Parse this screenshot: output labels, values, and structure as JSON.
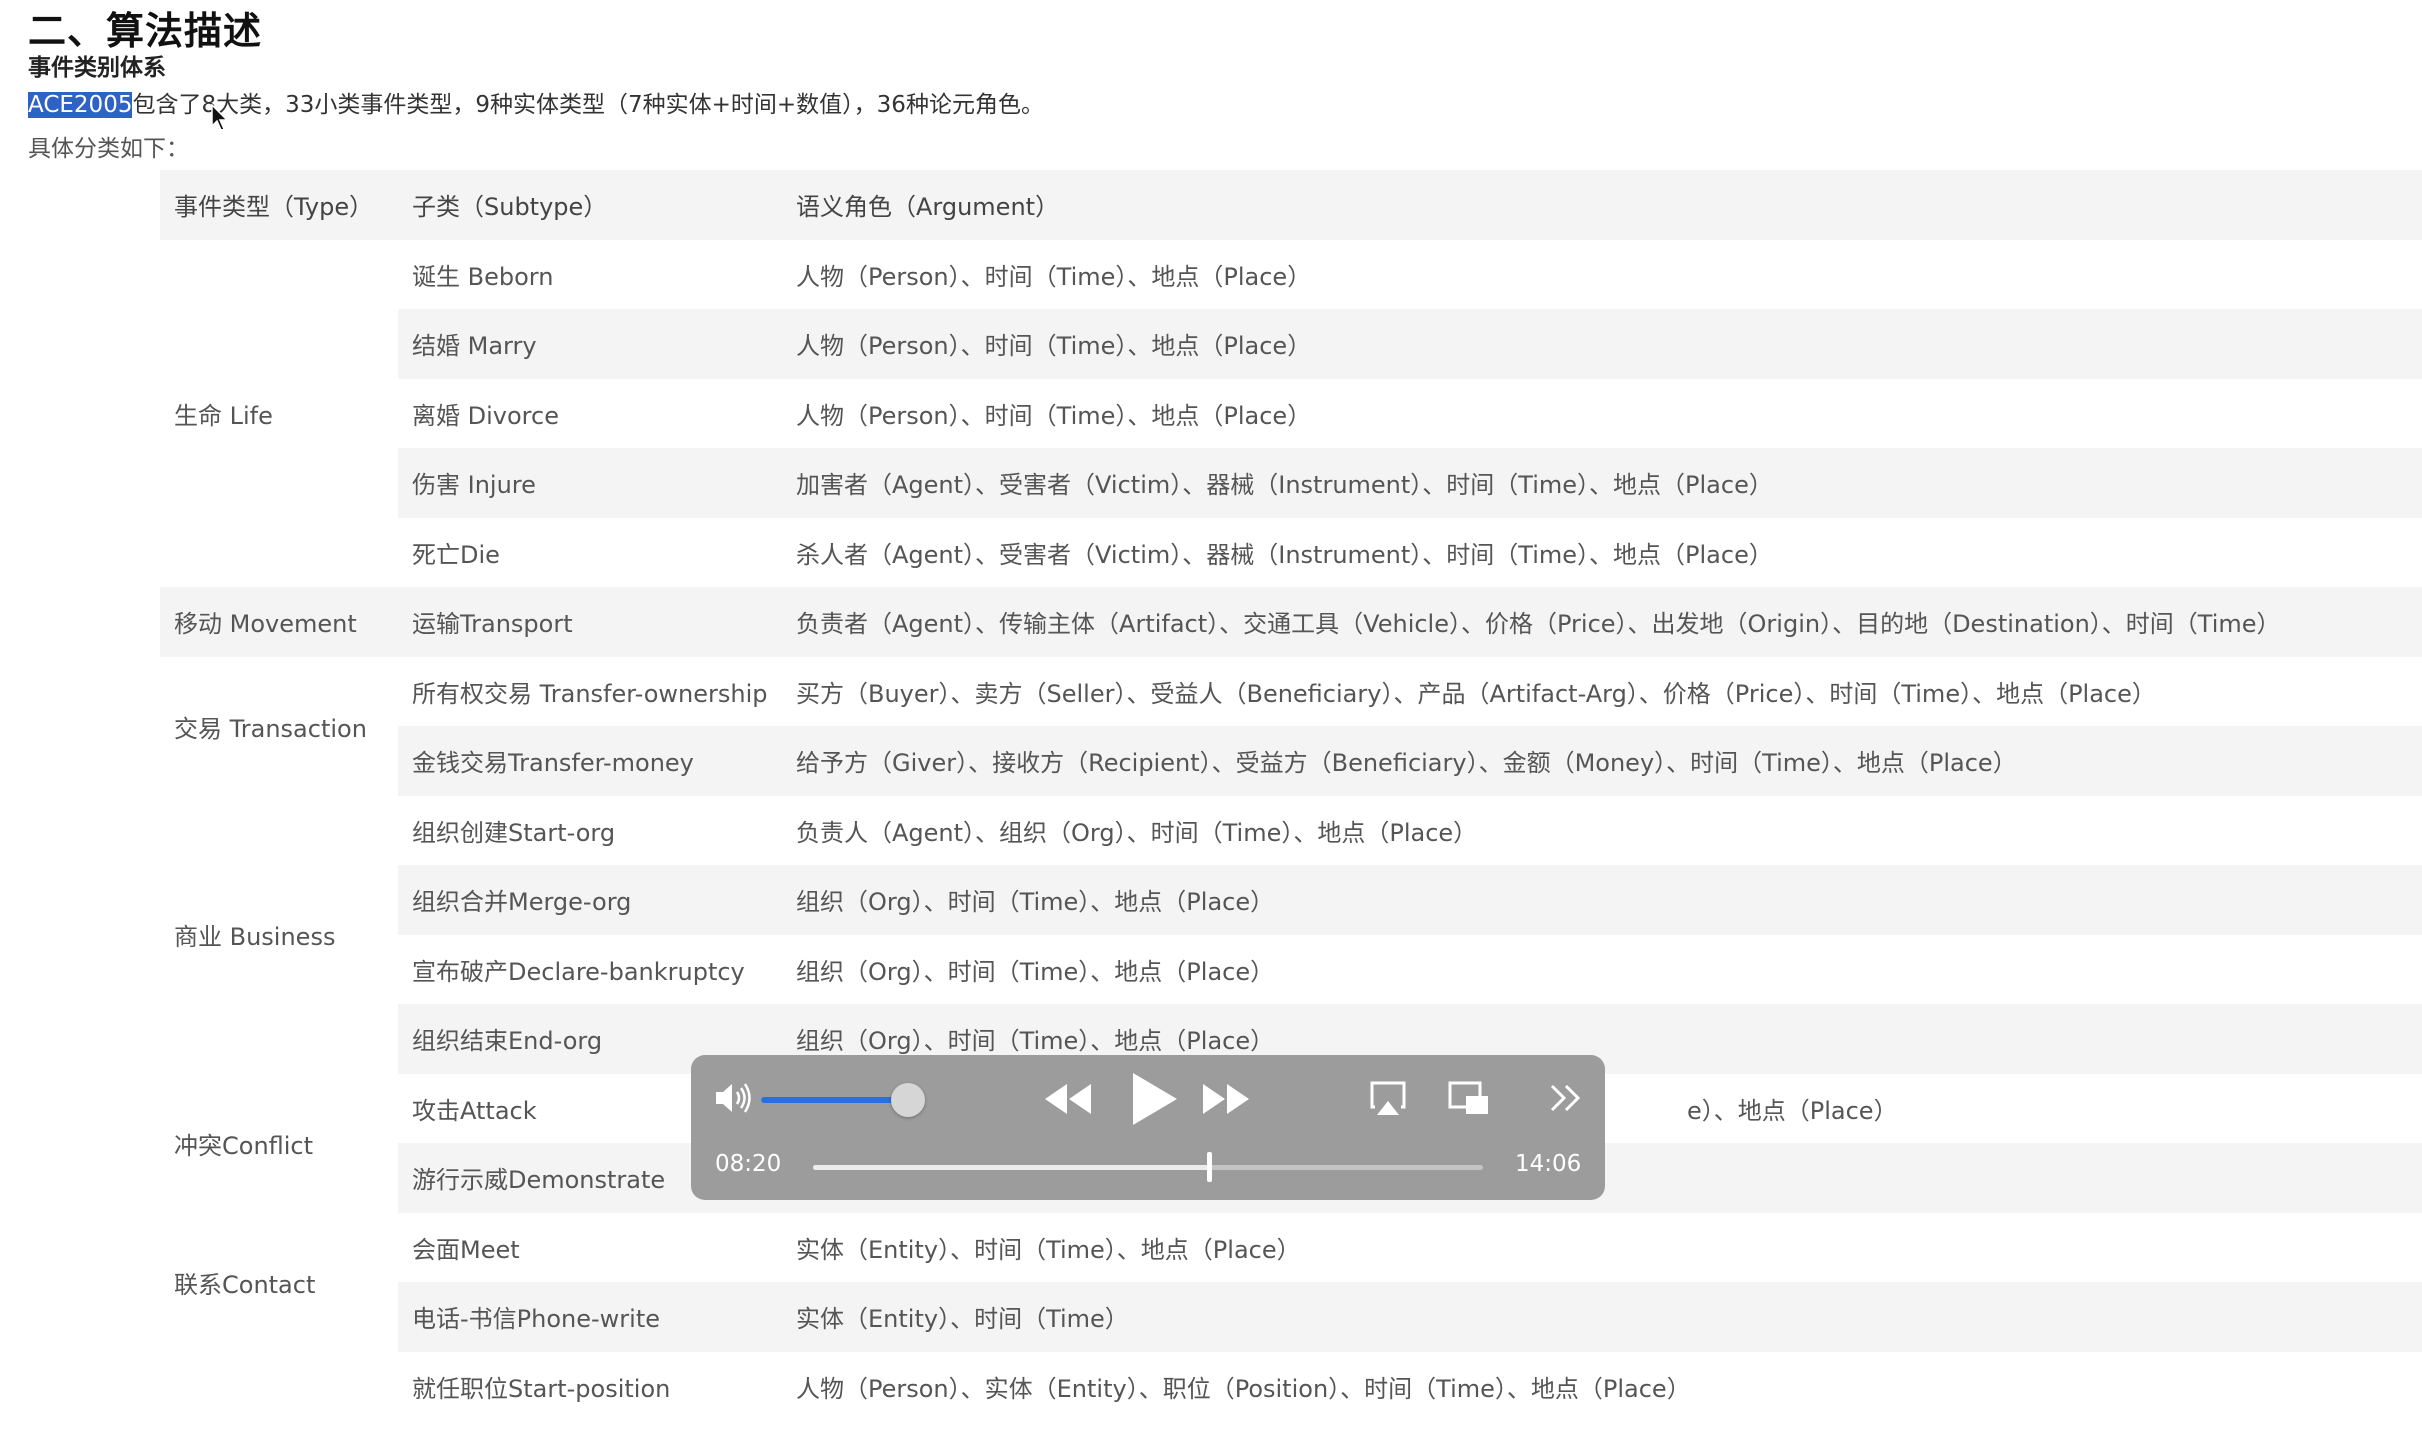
{
  "document": {
    "section_title": "二、算法描述",
    "subsection_title": "事件类别体系",
    "intro_highlight": "ACE2005",
    "intro_rest": "包含了8大类，33小类事件类型，9种实体类型（7种实体+时间+数值），36种论元角色。",
    "detail_line": "具体分类如下："
  },
  "table": {
    "headers": [
      "事件类型（Type）",
      "子类（Subtype）",
      "语义角色（Argument）"
    ],
    "types": {
      "life": "生命 Life",
      "movement": "移动 Movement",
      "transaction": "交易 Transaction",
      "business": "商业 Business",
      "conflict": "冲突Conflict",
      "contact": "联系Contact"
    },
    "rows": [
      {
        "subtype": "诞生 Beborn",
        "argument": "人物（Person）、时间（Time）、地点（Place）"
      },
      {
        "subtype": "结婚 Marry",
        "argument": "人物（Person）、时间（Time）、地点（Place）"
      },
      {
        "subtype": "离婚 Divorce",
        "argument": "人物（Person）、时间（Time）、地点（Place）"
      },
      {
        "subtype": "伤害 Injure",
        "argument": "加害者（Agent）、受害者（Victim）、器械（Instrument）、时间（Time）、地点（Place）"
      },
      {
        "subtype": "死亡Die",
        "argument": "杀人者（Agent）、受害者（Victim）、器械（Instrument）、时间（Time）、地点（Place）"
      },
      {
        "subtype": "运输Transport",
        "argument": "负责者（Agent）、传输主体（Artifact）、交通工具（Vehicle）、价格（Price）、出发地（Origin）、目的地（Destination）、时间（Time）"
      },
      {
        "subtype": "所有权交易 Transfer-ownership",
        "argument": "买方（Buyer）、卖方（Seller）、受益人（Beneficiary）、产品（Artifact-Arg）、价格（Price）、时间（Time）、地点（Place）"
      },
      {
        "subtype": "金钱交易Transfer-money",
        "argument": "给予方（Giver）、接收方（Recipient）、受益方（Beneficiary）、金额（Money）、时间（Time）、地点（Place）"
      },
      {
        "subtype": "组织创建Start-org",
        "argument": "负责人（Agent）、组织（Org）、时间（Time）、地点（Place）"
      },
      {
        "subtype": "组织合并Merge-org",
        "argument": "组织（Org）、时间（Time）、地点（Place）"
      },
      {
        "subtype": "宣布破产Declare-bankruptcy",
        "argument": "组织（Org）、时间（Time）、地点（Place）"
      },
      {
        "subtype": "组织结束End-org",
        "argument": "组织（Org）、时间（Time）、地点（Place）"
      },
      {
        "subtype": "攻击Attack",
        "argument": "e）、地点（Place）"
      },
      {
        "subtype": "游行示威Demonstrate",
        "argument": ""
      },
      {
        "subtype": "会面Meet",
        "argument": "实体（Entity）、时间（Time）、地点（Place）"
      },
      {
        "subtype": "电话-书信Phone-write",
        "argument": "实体（Entity）、时间（Time）"
      },
      {
        "subtype": "就任职位Start-position",
        "argument": "人物（Person）、实体（Entity）、职位（Position）、时间（Time）、地点（Place）"
      }
    ]
  },
  "player": {
    "current_time": "08:20",
    "total_time": "14:06",
    "progress": 0.591,
    "volume": 0.92,
    "accent_color": "#2a6fe0",
    "icons": {
      "volume": "speaker-icon",
      "rewind": "rewind-icon",
      "play": "play-icon",
      "forward": "fast-forward-icon",
      "airplay": "airplay-icon",
      "pip": "picture-in-picture-icon",
      "more": "more-icon"
    }
  }
}
